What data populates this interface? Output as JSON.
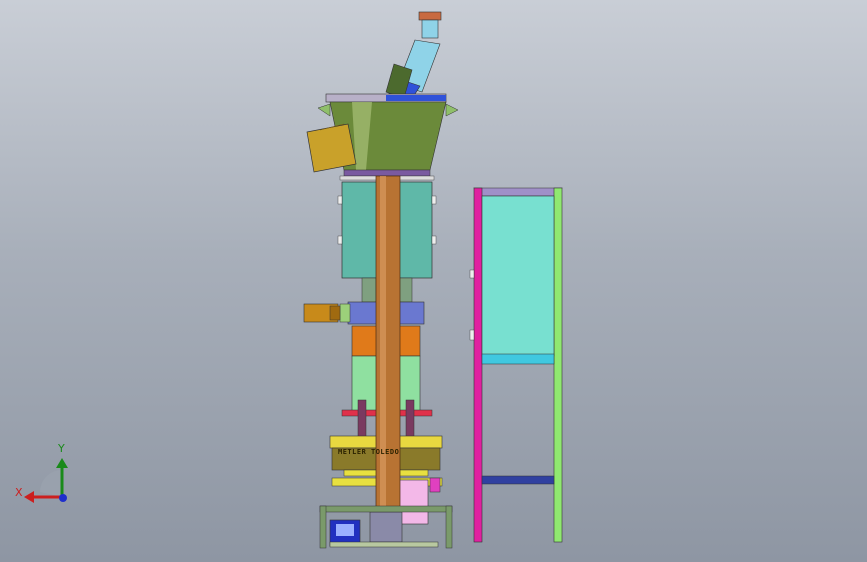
{
  "viewport": {
    "background": [
      "#c9ced6",
      "#8e96a3"
    ],
    "axes": {
      "x_label": "X",
      "y_label": "Y",
      "x_color": "#cc1f1f",
      "y_color": "#1a8a1a",
      "z_color": "#1f2fcc"
    }
  },
  "model": {
    "plate_text": "METLER TOLEDO",
    "colors": {
      "hopper": "#6b8a3a",
      "hopper_rim_blue": "#2f52d9",
      "inlet_pipe": "#8fd3e8",
      "motor_box": "#c9a12a",
      "cabinet": "#5fb8a8",
      "column": "#b87333",
      "orange_block": "#e07a1a",
      "green_block": "#8fe0a0",
      "yellow_plate": "#e8d840",
      "olive_plate": "#8a7a2a",
      "pink_panel": "#f3b8e8",
      "frame_magenta": "#e020a0",
      "frame_green": "#90e870",
      "frame_panel": "#78e0d0",
      "frame_bar": "#3040a0"
    }
  }
}
